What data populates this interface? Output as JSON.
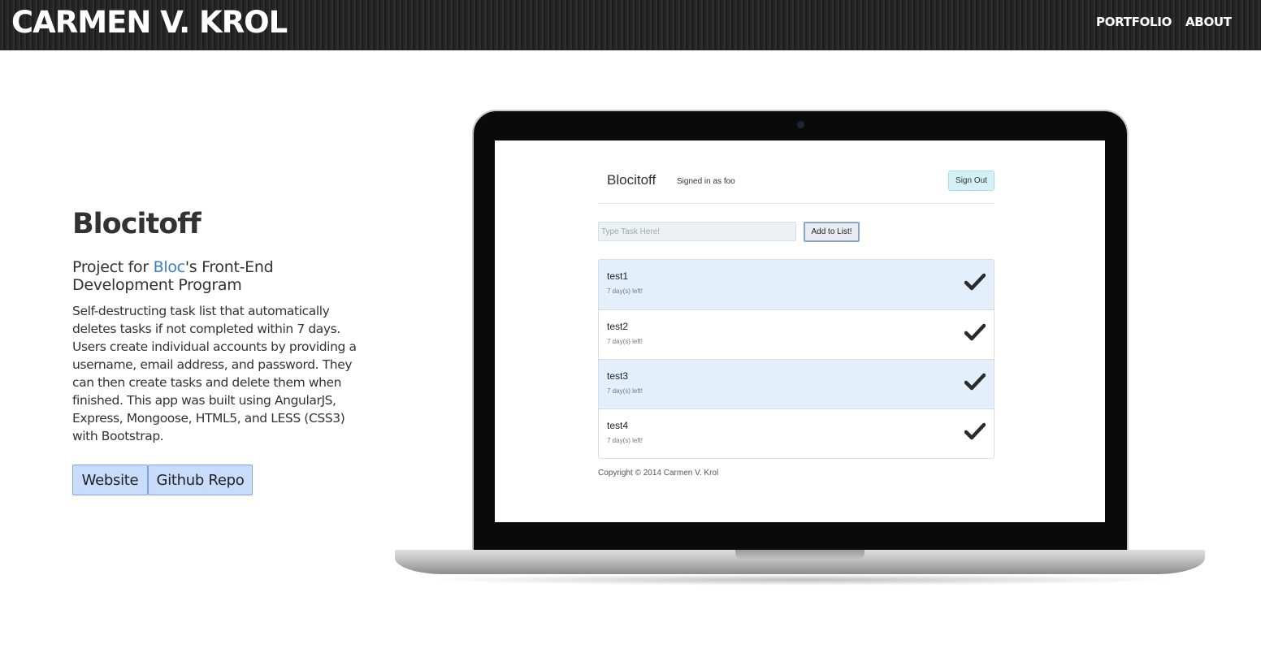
{
  "header": {
    "brand": "CARMEN V. KROL",
    "nav": [
      {
        "label": "PORTFOLIO"
      },
      {
        "label": "ABOUT"
      }
    ]
  },
  "project": {
    "title": "Blocitoff",
    "subtitle_prefix": "Project for ",
    "subtitle_link": "Bloc",
    "subtitle_suffix": "'s Front-End Development Program",
    "description": "Self-destructing task list that automatically deletes tasks if not completed within 7 days. Users create individual accounts by providing a username, email address, and password. They can then create tasks and delete them when finished. This app was built using AngularJS, Express, Mongoose, HTML5, and LESS (CSS3) with Bootstrap.",
    "buttons": {
      "website": "Website",
      "github": "Github Repo"
    }
  },
  "screenshot_app": {
    "brand": "Blocitoff",
    "signed_in": "Signed in as foo",
    "sign_out": "Sign Out",
    "task_input_placeholder": "Type Task Here!",
    "add_button": "Add to List!",
    "tasks": [
      {
        "name": "test1",
        "days_left": "7 day(s) left!"
      },
      {
        "name": "test2",
        "days_left": "7 day(s) left!"
      },
      {
        "name": "test3",
        "days_left": "7 day(s) left!"
      },
      {
        "name": "test4",
        "days_left": "7 day(s) left!"
      }
    ],
    "copyright": "Copyright © 2014 Carmen V. Krol"
  },
  "colors": {
    "link_blue": "#3a7fc6",
    "button_fill": "#c9dcfb",
    "task_highlight": "#e3f0fc",
    "signout_fill": "#d4f1f6"
  },
  "icons": {
    "task_done": "checkmark-icon"
  }
}
